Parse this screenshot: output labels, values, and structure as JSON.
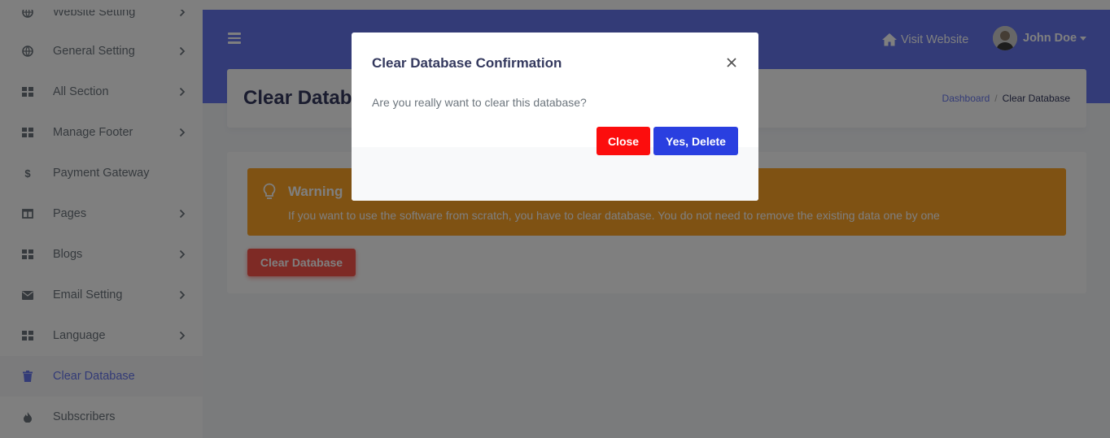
{
  "sidebar": {
    "items": [
      {
        "label": "Website Setting",
        "icon": "globe-icon",
        "chevron": true
      },
      {
        "label": "General Setting",
        "icon": "globe-icon",
        "chevron": true
      },
      {
        "label": "All Section",
        "icon": "grid-icon",
        "chevron": true
      },
      {
        "label": "Manage Footer",
        "icon": "grid-icon",
        "chevron": true
      },
      {
        "label": "Payment Gateway",
        "icon": "dollar-icon",
        "chevron": false
      },
      {
        "label": "Pages",
        "icon": "columns-icon",
        "chevron": true
      },
      {
        "label": "Blogs",
        "icon": "grid-icon",
        "chevron": true
      },
      {
        "label": "Email Setting",
        "icon": "envelope-icon",
        "chevron": true
      },
      {
        "label": "Language",
        "icon": "grid-icon",
        "chevron": true
      },
      {
        "label": "Clear Database",
        "icon": "trash-icon",
        "chevron": false,
        "active": true
      },
      {
        "label": "Subscribers",
        "icon": "fire-icon",
        "chevron": false
      }
    ]
  },
  "navbar": {
    "visit_label": "Visit Website",
    "user_name": "John Doe"
  },
  "page": {
    "title": "Clear Database",
    "breadcrumb": {
      "home": "Dashboard",
      "current": "Clear Database"
    }
  },
  "alert": {
    "title": "Warning",
    "message": "If you want to use the software from scratch, you have to clear database. You do not need to remove the existing data one by one"
  },
  "main": {
    "clear_button": "Clear Database"
  },
  "modal": {
    "title": "Clear Database Confirmation",
    "body": "Are you really want to clear this database?",
    "close_button": "Close",
    "confirm_button": "Yes, Delete"
  },
  "colors": {
    "primary": "#6777ef",
    "warning": "#ffa426",
    "danger": "#fc544b",
    "modal_close": "#fc0d0d",
    "modal_confirm": "#2a3fe0"
  }
}
